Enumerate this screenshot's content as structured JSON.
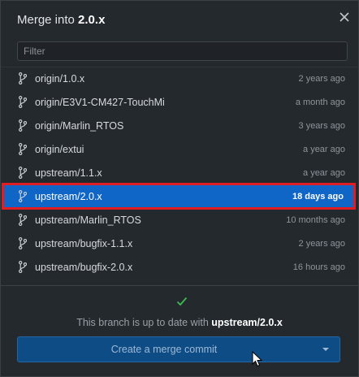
{
  "dialog": {
    "title_prefix": "Merge into ",
    "title_branch": "2.0.x",
    "close_icon": "close-icon"
  },
  "filter": {
    "placeholder": "Filter",
    "value": ""
  },
  "branches": [
    {
      "name": "origin/1.0.x",
      "time": "2 years ago",
      "selected": false
    },
    {
      "name": "origin/E3V1-CM427-TouchMi",
      "time": "a month ago",
      "selected": false
    },
    {
      "name": "origin/Marlin_RTOS",
      "time": "3 years ago",
      "selected": false
    },
    {
      "name": "origin/extui",
      "time": "a year ago",
      "selected": false
    },
    {
      "name": "upstream/1.1.x",
      "time": "a year ago",
      "selected": false
    },
    {
      "name": "upstream/2.0.x",
      "time": "18 days ago",
      "selected": true
    },
    {
      "name": "upstream/Marlin_RTOS",
      "time": "10 months ago",
      "selected": false
    },
    {
      "name": "upstream/bugfix-1.1.x",
      "time": "2 years ago",
      "selected": false
    },
    {
      "name": "upstream/bugfix-2.0.x",
      "time": "16 hours ago",
      "selected": false
    }
  ],
  "status": {
    "text_prefix": "This branch is up to date with ",
    "branch": "upstream/2.0.x",
    "icon": "checkmark-icon"
  },
  "merge_button": {
    "label": "Create a merge commit",
    "dropdown_icon": "caret-down-icon"
  },
  "colors": {
    "background": "#24292e",
    "selected": "#0f66c7",
    "highlight_border": "#e11d24",
    "check": "#3fb950",
    "button": "#0e4c85"
  }
}
